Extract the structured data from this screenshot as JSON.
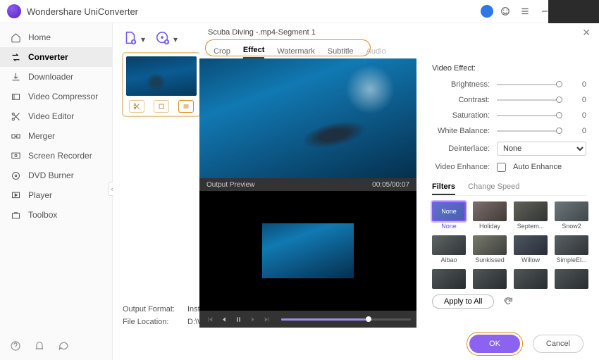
{
  "app_title": "Wondershare UniConverter",
  "sidebar": {
    "items": [
      {
        "label": "Home"
      },
      {
        "label": "Converter"
      },
      {
        "label": "Downloader"
      },
      {
        "label": "Video Compressor"
      },
      {
        "label": "Video Editor"
      },
      {
        "label": "Merger"
      },
      {
        "label": "Screen Recorder"
      },
      {
        "label": "DVD Burner"
      },
      {
        "label": "Player"
      },
      {
        "label": "Toolbox"
      }
    ]
  },
  "main": {
    "output_format_label": "Output Format:",
    "output_format_value": "Instagram F",
    "file_location_label": "File Location:",
    "file_location_value": "D:\\Wonder"
  },
  "dialog": {
    "title": "Scuba Diving -.mp4-Segment 1",
    "tabs": [
      "Crop",
      "Effect",
      "Watermark",
      "Subtitle",
      "Audio"
    ],
    "active_tab": "Effect",
    "output_preview_label": "Output Preview",
    "time": "00:05/00:07",
    "effects": {
      "head": "Video Effect:",
      "sliders": [
        {
          "label": "Brightness:",
          "value": "0"
        },
        {
          "label": "Contrast:",
          "value": "0"
        },
        {
          "label": "Saturation:",
          "value": "0"
        },
        {
          "label": "White Balance:",
          "value": "0"
        }
      ],
      "deinterlace_label": "Deinterlace:",
      "deinterlace_value": "None",
      "enhance_label": "Video Enhance:",
      "enhance_text": "Auto Enhance"
    },
    "subtabs": [
      "Filters",
      "Change Speed"
    ],
    "filters": [
      {
        "name": "None"
      },
      {
        "name": "Holiday"
      },
      {
        "name": "Septem..."
      },
      {
        "name": "Snow2"
      },
      {
        "name": "Aibao"
      },
      {
        "name": "Sunkissed"
      },
      {
        "name": "Willow"
      },
      {
        "name": "SimpleEl..."
      }
    ],
    "apply_all": "Apply to All",
    "ok": "OK",
    "cancel": "Cancel"
  }
}
